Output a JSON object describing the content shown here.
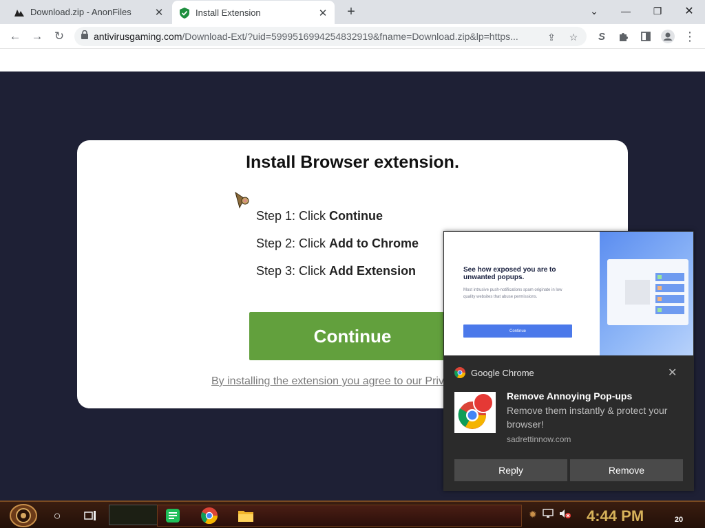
{
  "tabs": [
    {
      "title": "Download.zip - AnonFiles",
      "active": false
    },
    {
      "title": "Install Extension",
      "active": true
    }
  ],
  "address": {
    "domain": "antivirusgaming.com",
    "path": "/Download-Ext/?uid=5999516994254832919&fname=Download.zip&lp=https..."
  },
  "page": {
    "title": "Install Browser extension.",
    "steps": [
      {
        "prefix": "Step 1: Click ",
        "action": "Continue"
      },
      {
        "prefix": "Step 2: Click ",
        "action": "Add to Chrome"
      },
      {
        "prefix": "Step 3: Click ",
        "action": "Add Extension"
      }
    ],
    "continue_label": "Continue",
    "agree_text": "By installing the extension you agree to our Privacy"
  },
  "notification": {
    "hero_title": "See how exposed you are to unwanted popups.",
    "hero_text": "Most intrusive push-notifications spam originate in low quality websites that abuse permissions.",
    "hero_button": "Continue",
    "app": "Google Chrome",
    "title": "Remove Annoying Pop-ups",
    "body": "Remove them instantly & protect your browser!",
    "site": "sadrettinnow.com",
    "reply_label": "Reply",
    "remove_label": "Remove"
  },
  "taskbar": {
    "time": "4:44 PM",
    "notification_count": "20"
  },
  "colors": {
    "page_background": "#1e2035",
    "continue_button": "#62a03d",
    "clock": "#d7b25a"
  }
}
